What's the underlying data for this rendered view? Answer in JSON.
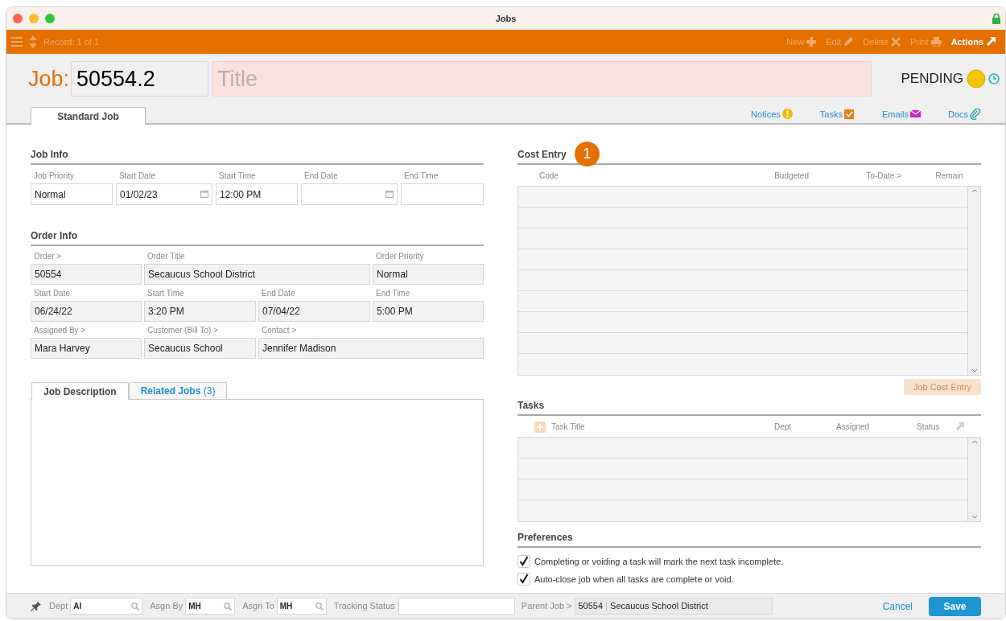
{
  "window": {
    "title": "Jobs"
  },
  "toolbar": {
    "record": "Record: 1 of 1",
    "actions": [
      {
        "label": "New",
        "kind": "plus",
        "enabled": false
      },
      {
        "label": "Edit",
        "kind": "pencil",
        "enabled": false
      },
      {
        "label": "Delete",
        "kind": "cross",
        "enabled": false
      },
      {
        "label": "Print",
        "kind": "printer",
        "enabled": false
      },
      {
        "label": "Actions",
        "kind": "arrow",
        "enabled": true
      }
    ]
  },
  "header": {
    "job_label": "Job:",
    "job_number": "50554.2",
    "title_placeholder": "Title",
    "status": "PENDING"
  },
  "tabs": [
    {
      "label": "Standard Job",
      "selected": true
    }
  ],
  "links": [
    {
      "label": "Notices",
      "kind": "notice"
    },
    {
      "label": "Tasks",
      "kind": "task"
    },
    {
      "label": "Emails",
      "kind": "email"
    },
    {
      "label": "Docs",
      "kind": "doc"
    }
  ],
  "job_info": {
    "title": "Job Info",
    "fields": [
      {
        "label": "Job Priority",
        "value": "Normal",
        "kind": "text"
      },
      {
        "label": "Start Date",
        "value": "01/02/23",
        "kind": "date"
      },
      {
        "label": "Start Time",
        "value": "12:00 PM",
        "kind": "text"
      },
      {
        "label": "End Date",
        "kind": "date"
      },
      {
        "label": "End Time",
        "kind": "text"
      }
    ]
  },
  "order_info": {
    "title": "Order Info",
    "fields": [
      {
        "label": "Order >",
        "value": "50554"
      },
      {
        "label": "Order Title",
        "value": "Secaucus School District"
      },
      {
        "label": "Order Priority",
        "value": "Normal"
      },
      {
        "label": "Start Date",
        "value": "06/24/22"
      },
      {
        "label": "Start Time",
        "value": "3:20 PM"
      },
      {
        "label": "End Date",
        "value": "07/04/22"
      },
      {
        "label": "End Time",
        "value": "5:00 PM"
      },
      {
        "label": "Assigned By >",
        "value": "Mara Harvey"
      },
      {
        "label": "Customer (Bill To) >",
        "value": "Secaucus School"
      },
      {
        "label": "Contact >",
        "value": "Jennifer Madison"
      }
    ]
  },
  "description_tabs": [
    {
      "label": "Job Description",
      "selected": true
    },
    {
      "label": "Related Jobs",
      "count": "(3)",
      "selected": false
    }
  ],
  "cost_entry": {
    "title": "Cost Entry",
    "badge": "1",
    "columns": [
      "Code",
      "Budgeted",
      "To-Date >",
      "Remain"
    ],
    "button": {
      "label": "Job Cost Entry",
      "disabled": true
    }
  },
  "tasks": {
    "title": "Tasks",
    "columns": [
      "Task Title",
      "Dept",
      "Assigned",
      "Status"
    ]
  },
  "preferences": {
    "title": "Preferences",
    "options": [
      {
        "label": "Completing or voiding a task will mark the next task incomplete.",
        "checked": true
      },
      {
        "label": "Auto-close job when all tasks are complete or void.",
        "checked": true
      }
    ]
  },
  "bottom_bar": {
    "filters": [
      {
        "label": "Dept",
        "value": "AI"
      },
      {
        "label": "Asgn By",
        "value": "MH"
      },
      {
        "label": "Asgn To",
        "value": "MH"
      }
    ],
    "tracking_status": "Tracking Status",
    "parent_job_label": "Parent Job >",
    "parent_job_number": "50554",
    "parent_job_title": "Secaucus School District",
    "cancel": "Cancel",
    "save": "Save"
  }
}
